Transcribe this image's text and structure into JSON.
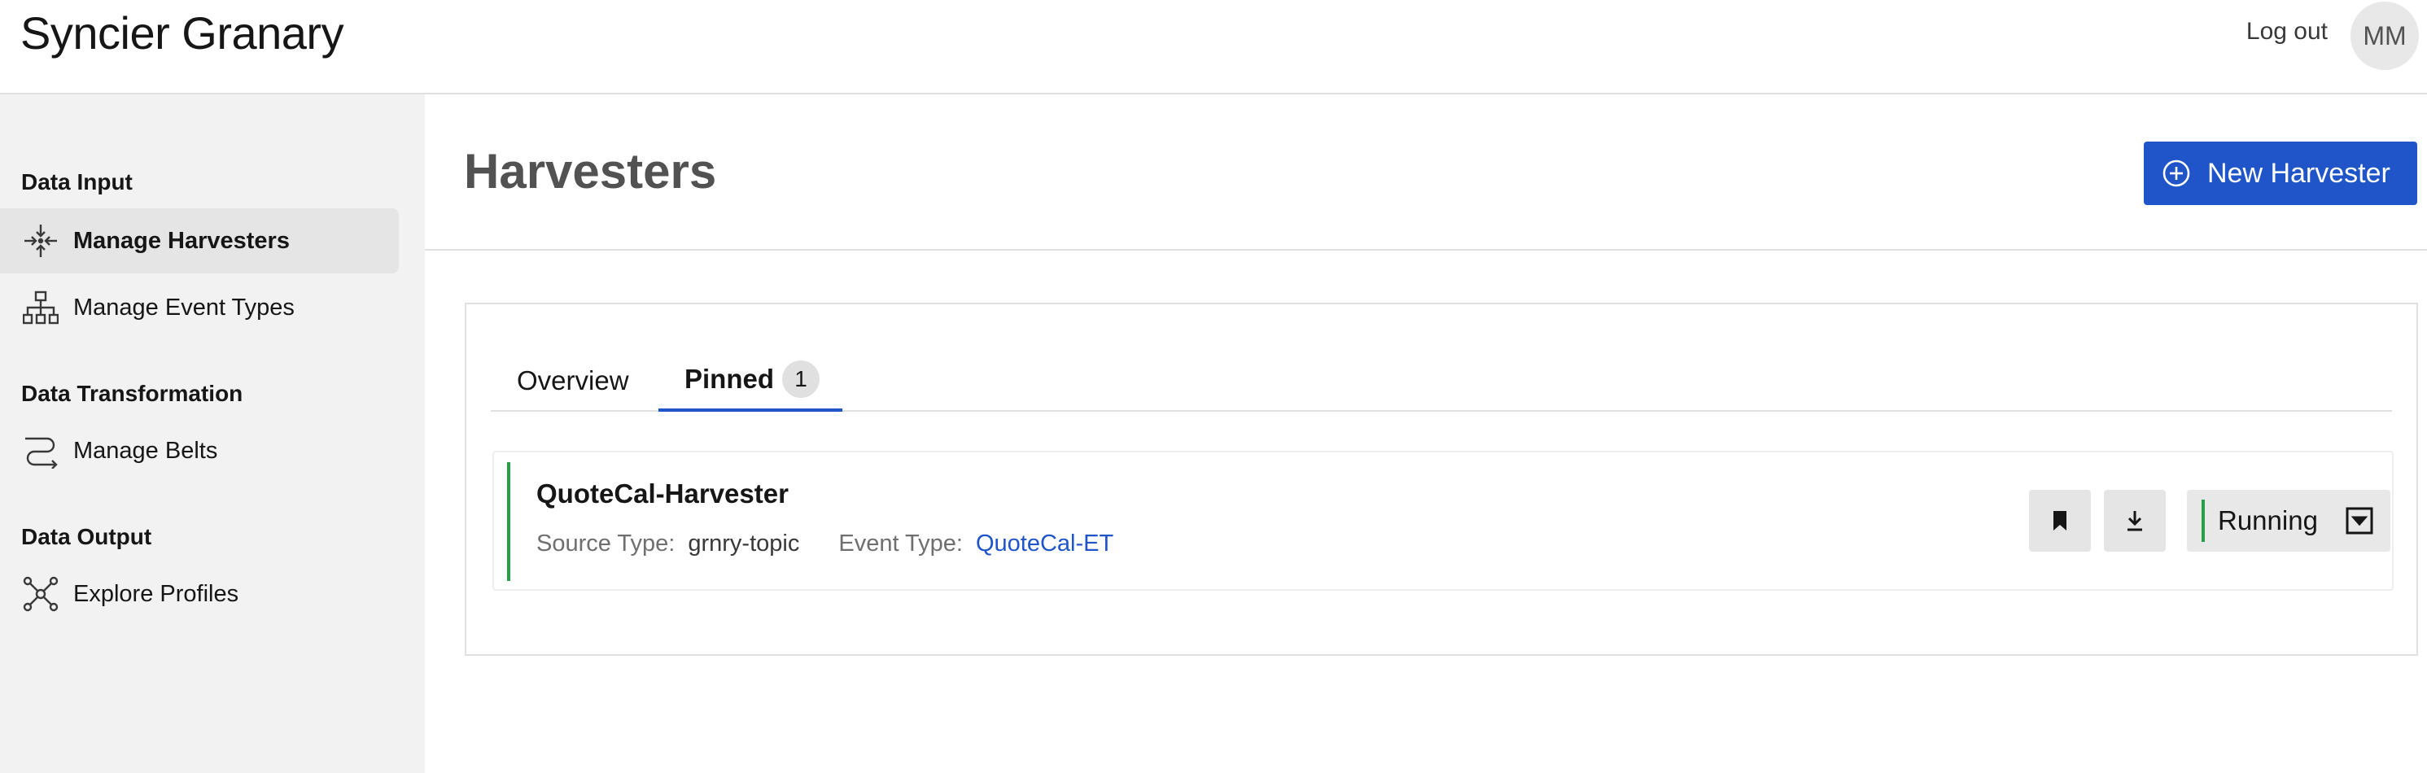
{
  "app": {
    "title": "Syncier Granary",
    "logout_label": "Log out",
    "avatar_initials": "MM"
  },
  "sidebar": {
    "sections": [
      {
        "title": "Data Input"
      },
      {
        "title": "Data Transformation"
      },
      {
        "title": "Data Output"
      }
    ],
    "items": [
      {
        "label": "Manage Harvesters",
        "icon": "harvester-icon",
        "active": true
      },
      {
        "label": "Manage Event Types",
        "icon": "hierarchy-icon",
        "active": false
      },
      {
        "label": "Manage Belts",
        "icon": "belt-icon",
        "active": false
      },
      {
        "label": "Explore Profiles",
        "icon": "network-icon",
        "active": false
      }
    ]
  },
  "page": {
    "title": "Harvesters",
    "new_button_label": "New Harvester"
  },
  "tabs": [
    {
      "label": "Overview",
      "active": false
    },
    {
      "label": "Pinned",
      "count": "1",
      "active": true
    }
  ],
  "harvesters": [
    {
      "name": "QuoteCal-Harvester",
      "source_type_label": "Source Type:",
      "source_type": "grnry-topic",
      "event_type_label": "Event Type:",
      "event_type": "QuoteCal-ET",
      "status": "Running"
    }
  ],
  "colors": {
    "accent": "#1f55c9",
    "status_running": "#24a148"
  }
}
